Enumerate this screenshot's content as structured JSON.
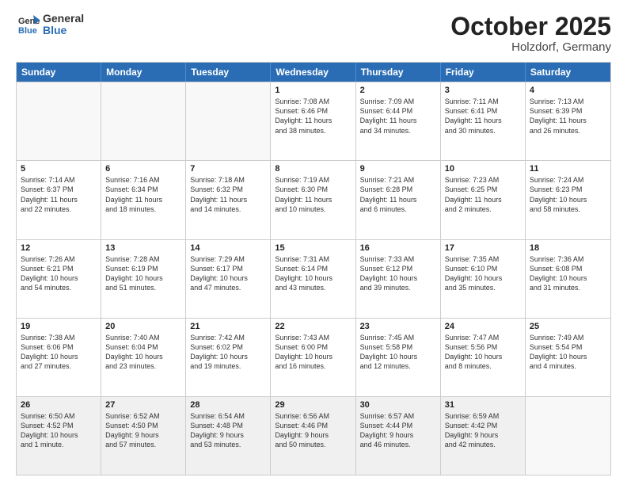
{
  "header": {
    "logo_line1": "General",
    "logo_line2": "Blue",
    "month_year": "October 2025",
    "location": "Holzdorf, Germany"
  },
  "weekdays": [
    "Sunday",
    "Monday",
    "Tuesday",
    "Wednesday",
    "Thursday",
    "Friday",
    "Saturday"
  ],
  "rows": [
    [
      {
        "day": "",
        "empty": true
      },
      {
        "day": "",
        "empty": true
      },
      {
        "day": "",
        "empty": true
      },
      {
        "day": "1",
        "lines": [
          "Sunrise: 7:08 AM",
          "Sunset: 6:46 PM",
          "Daylight: 11 hours",
          "and 38 minutes."
        ]
      },
      {
        "day": "2",
        "lines": [
          "Sunrise: 7:09 AM",
          "Sunset: 6:44 PM",
          "Daylight: 11 hours",
          "and 34 minutes."
        ]
      },
      {
        "day": "3",
        "lines": [
          "Sunrise: 7:11 AM",
          "Sunset: 6:41 PM",
          "Daylight: 11 hours",
          "and 30 minutes."
        ]
      },
      {
        "day": "4",
        "lines": [
          "Sunrise: 7:13 AM",
          "Sunset: 6:39 PM",
          "Daylight: 11 hours",
          "and 26 minutes."
        ]
      }
    ],
    [
      {
        "day": "5",
        "lines": [
          "Sunrise: 7:14 AM",
          "Sunset: 6:37 PM",
          "Daylight: 11 hours",
          "and 22 minutes."
        ]
      },
      {
        "day": "6",
        "lines": [
          "Sunrise: 7:16 AM",
          "Sunset: 6:34 PM",
          "Daylight: 11 hours",
          "and 18 minutes."
        ]
      },
      {
        "day": "7",
        "lines": [
          "Sunrise: 7:18 AM",
          "Sunset: 6:32 PM",
          "Daylight: 11 hours",
          "and 14 minutes."
        ]
      },
      {
        "day": "8",
        "lines": [
          "Sunrise: 7:19 AM",
          "Sunset: 6:30 PM",
          "Daylight: 11 hours",
          "and 10 minutes."
        ]
      },
      {
        "day": "9",
        "lines": [
          "Sunrise: 7:21 AM",
          "Sunset: 6:28 PM",
          "Daylight: 11 hours",
          "and 6 minutes."
        ]
      },
      {
        "day": "10",
        "lines": [
          "Sunrise: 7:23 AM",
          "Sunset: 6:25 PM",
          "Daylight: 11 hours",
          "and 2 minutes."
        ]
      },
      {
        "day": "11",
        "lines": [
          "Sunrise: 7:24 AM",
          "Sunset: 6:23 PM",
          "Daylight: 10 hours",
          "and 58 minutes."
        ]
      }
    ],
    [
      {
        "day": "12",
        "lines": [
          "Sunrise: 7:26 AM",
          "Sunset: 6:21 PM",
          "Daylight: 10 hours",
          "and 54 minutes."
        ]
      },
      {
        "day": "13",
        "lines": [
          "Sunrise: 7:28 AM",
          "Sunset: 6:19 PM",
          "Daylight: 10 hours",
          "and 51 minutes."
        ]
      },
      {
        "day": "14",
        "lines": [
          "Sunrise: 7:29 AM",
          "Sunset: 6:17 PM",
          "Daylight: 10 hours",
          "and 47 minutes."
        ]
      },
      {
        "day": "15",
        "lines": [
          "Sunrise: 7:31 AM",
          "Sunset: 6:14 PM",
          "Daylight: 10 hours",
          "and 43 minutes."
        ]
      },
      {
        "day": "16",
        "lines": [
          "Sunrise: 7:33 AM",
          "Sunset: 6:12 PM",
          "Daylight: 10 hours",
          "and 39 minutes."
        ]
      },
      {
        "day": "17",
        "lines": [
          "Sunrise: 7:35 AM",
          "Sunset: 6:10 PM",
          "Daylight: 10 hours",
          "and 35 minutes."
        ]
      },
      {
        "day": "18",
        "lines": [
          "Sunrise: 7:36 AM",
          "Sunset: 6:08 PM",
          "Daylight: 10 hours",
          "and 31 minutes."
        ]
      }
    ],
    [
      {
        "day": "19",
        "lines": [
          "Sunrise: 7:38 AM",
          "Sunset: 6:06 PM",
          "Daylight: 10 hours",
          "and 27 minutes."
        ]
      },
      {
        "day": "20",
        "lines": [
          "Sunrise: 7:40 AM",
          "Sunset: 6:04 PM",
          "Daylight: 10 hours",
          "and 23 minutes."
        ]
      },
      {
        "day": "21",
        "lines": [
          "Sunrise: 7:42 AM",
          "Sunset: 6:02 PM",
          "Daylight: 10 hours",
          "and 19 minutes."
        ]
      },
      {
        "day": "22",
        "lines": [
          "Sunrise: 7:43 AM",
          "Sunset: 6:00 PM",
          "Daylight: 10 hours",
          "and 16 minutes."
        ]
      },
      {
        "day": "23",
        "lines": [
          "Sunrise: 7:45 AM",
          "Sunset: 5:58 PM",
          "Daylight: 10 hours",
          "and 12 minutes."
        ]
      },
      {
        "day": "24",
        "lines": [
          "Sunrise: 7:47 AM",
          "Sunset: 5:56 PM",
          "Daylight: 10 hours",
          "and 8 minutes."
        ]
      },
      {
        "day": "25",
        "lines": [
          "Sunrise: 7:49 AM",
          "Sunset: 5:54 PM",
          "Daylight: 10 hours",
          "and 4 minutes."
        ]
      }
    ],
    [
      {
        "day": "26",
        "lines": [
          "Sunrise: 6:50 AM",
          "Sunset: 4:52 PM",
          "Daylight: 10 hours",
          "and 1 minute."
        ]
      },
      {
        "day": "27",
        "lines": [
          "Sunrise: 6:52 AM",
          "Sunset: 4:50 PM",
          "Daylight: 9 hours",
          "and 57 minutes."
        ]
      },
      {
        "day": "28",
        "lines": [
          "Sunrise: 6:54 AM",
          "Sunset: 4:48 PM",
          "Daylight: 9 hours",
          "and 53 minutes."
        ]
      },
      {
        "day": "29",
        "lines": [
          "Sunrise: 6:56 AM",
          "Sunset: 4:46 PM",
          "Daylight: 9 hours",
          "and 50 minutes."
        ]
      },
      {
        "day": "30",
        "lines": [
          "Sunrise: 6:57 AM",
          "Sunset: 4:44 PM",
          "Daylight: 9 hours",
          "and 46 minutes."
        ]
      },
      {
        "day": "31",
        "lines": [
          "Sunrise: 6:59 AM",
          "Sunset: 4:42 PM",
          "Daylight: 9 hours",
          "and 42 minutes."
        ]
      },
      {
        "day": "",
        "empty": true
      }
    ]
  ]
}
